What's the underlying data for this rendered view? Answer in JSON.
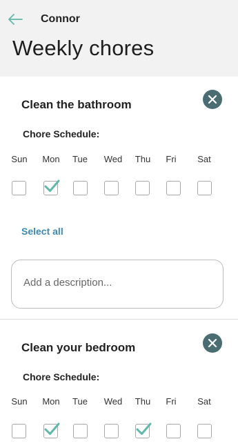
{
  "header": {
    "name": "Connor",
    "title": "Weekly chores"
  },
  "day_labels": [
    "Sun",
    "Mon",
    "Tue",
    "Wed",
    "Thu",
    "Fri",
    "Sat"
  ],
  "chores": [
    {
      "title": "Clean the bathroom",
      "schedule_label": "Chore Schedule:",
      "checked": [
        false,
        true,
        false,
        false,
        false,
        false,
        false
      ],
      "select_all_label": "Select all",
      "description_placeholder": "Add a description..."
    },
    {
      "title": "Clean your bedroom",
      "schedule_label": "Chore Schedule:",
      "checked": [
        false,
        true,
        false,
        false,
        true,
        false,
        false
      ]
    }
  ],
  "colors": {
    "accent": "#5fb8a8",
    "close_button": "#4a6d72",
    "link": "#3b8ab4",
    "header_bg": "#f2f2f2"
  },
  "icons": {
    "back": "arrow-left-icon",
    "close": "close-icon",
    "check": "checkmark-icon"
  }
}
